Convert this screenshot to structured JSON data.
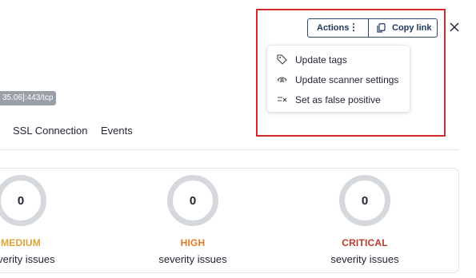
{
  "header": {
    "port_badge": "35.06]:443/tcp"
  },
  "toolbar": {
    "actions_label": "Actions",
    "actions_more_icon": "kebab-icon",
    "copy_link_label": "Copy link",
    "copy_icon": "copy-icon",
    "close_icon": "close-icon"
  },
  "actions_menu": {
    "items": [
      {
        "label": "Update tags",
        "icon": "tag-icon"
      },
      {
        "label": "Update scanner settings",
        "icon": "scanner-eye-icon"
      },
      {
        "label": "Set as false positive",
        "icon": "false-positive-icon"
      }
    ]
  },
  "tabs": [
    {
      "label": "SSL Connection"
    },
    {
      "label": "Events"
    }
  ],
  "severity": [
    {
      "count": "0",
      "name": "MEDIUM",
      "sub": "severity issues",
      "color": "#e0a232"
    },
    {
      "count": "0",
      "name": "HIGH",
      "sub": "severity issues",
      "color": "#e07b2a"
    },
    {
      "count": "0",
      "name": "CRITICAL",
      "sub": "severity issues",
      "color": "#c0392b"
    }
  ],
  "colors": {
    "accent": "#1f3a60",
    "highlight_box": "#d42a2a",
    "ring": "#d5d9de"
  }
}
